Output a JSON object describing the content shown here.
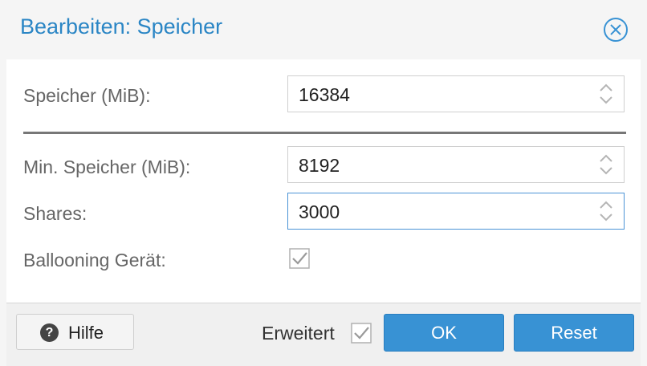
{
  "dialog": {
    "title": "Bearbeiten: Speicher"
  },
  "form": {
    "memory": {
      "label": "Speicher (MiB):",
      "value": "16384"
    },
    "min_memory": {
      "label": "Min. Speicher (MiB):",
      "value": "8192"
    },
    "shares": {
      "label": "Shares:",
      "value": "3000"
    },
    "ballooning": {
      "label": "Ballooning Gerät:",
      "checked": true
    }
  },
  "footer": {
    "help_label": "Hilfe",
    "advanced_label": "Erweitert",
    "advanced_checked": true,
    "ok_label": "OK",
    "reset_label": "Reset"
  },
  "colors": {
    "accent": "#2b86c5",
    "button": "#3892d4",
    "focus_border": "#4b94d6"
  },
  "icons": {
    "close": "close-circle-icon",
    "help": "question-circle-icon",
    "spinner": "chevron-up-down-icon",
    "checkbox": "checkmark-icon"
  }
}
